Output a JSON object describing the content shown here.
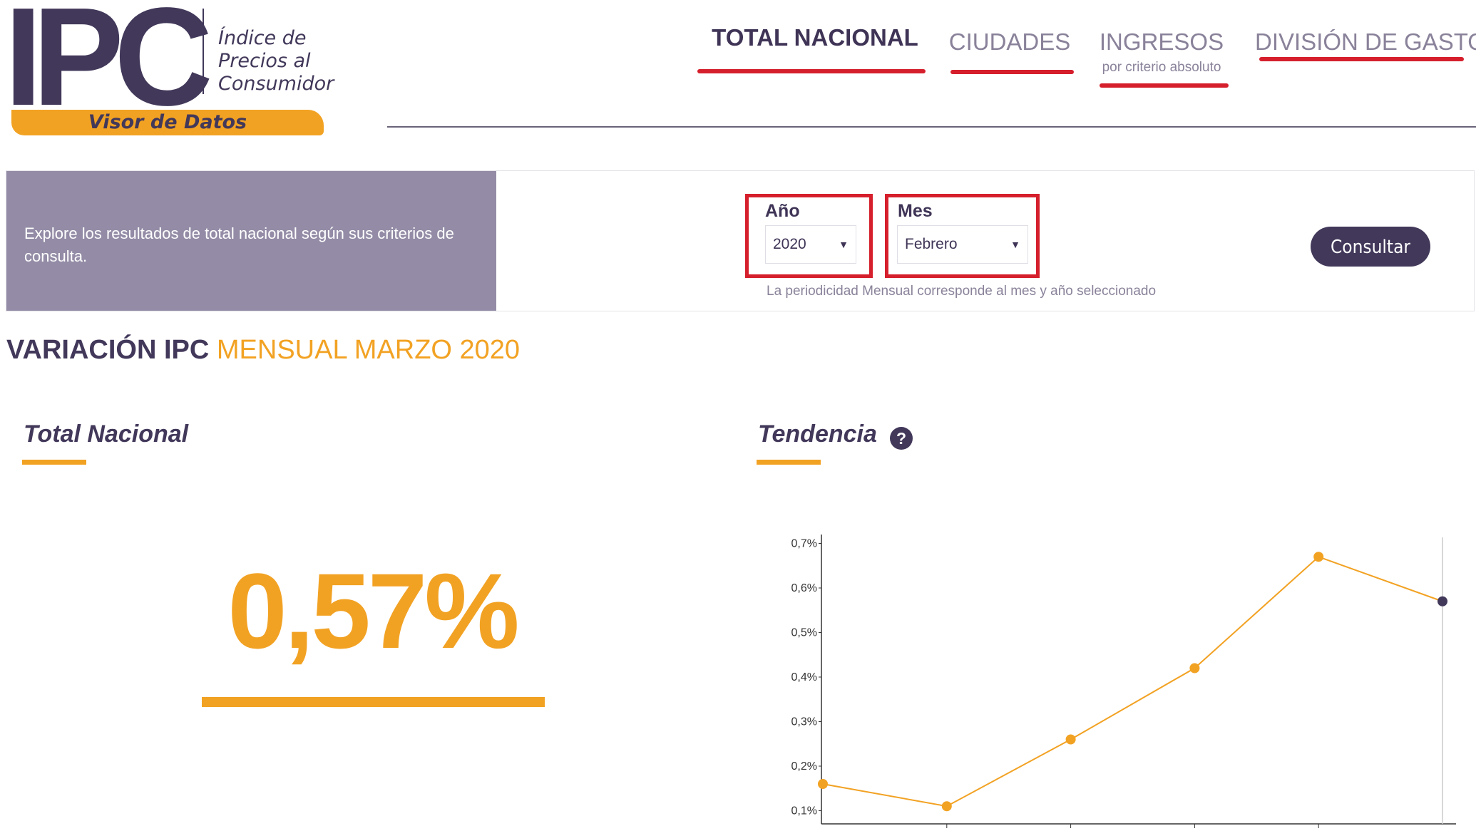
{
  "logo": {
    "mark": "IPC",
    "subtitle_lines": [
      "Índice de",
      "Precios al",
      "Consumidor"
    ],
    "ribbon": "Visor de Datos"
  },
  "nav": {
    "tabs": [
      {
        "label": "TOTAL NACIONAL",
        "sub": ""
      },
      {
        "label": "CIUDADES",
        "sub": ""
      },
      {
        "label": "INGRESOS",
        "sub": "por criterio absoluto"
      },
      {
        "label": "DIVISIÓN DE GASTO",
        "sub": ""
      }
    ]
  },
  "filter": {
    "intro": "Explore los resultados de total nacional según sus criterios de consulta.",
    "year_label": "Año",
    "year_value": "2020",
    "month_label": "Mes",
    "month_value": "Febrero",
    "note": "La periodicidad Mensual corresponde al mes y año seleccionado",
    "button": "Consultar"
  },
  "section": {
    "title_a": "VARIACIÓN IPC",
    "title_b": "MENSUAL MARZO 2020"
  },
  "total": {
    "title": "Total Nacional",
    "value": "0,57%"
  },
  "trend": {
    "title": "Tendencia",
    "help": "?"
  },
  "colors": {
    "primary": "#42385a",
    "accent": "#f2a223",
    "highlight_red": "#d61f2c",
    "panel": "#948ca6"
  },
  "chart_data": {
    "type": "line",
    "y_ticks": [
      "0,1%",
      "0,2%",
      "0,3%",
      "0,4%",
      "0,5%",
      "0,6%",
      "0,7%"
    ],
    "ylim": [
      0.08,
      0.72
    ],
    "series": [
      {
        "values": [
          0.16,
          0.11,
          0.26,
          0.42,
          0.67,
          0.57
        ]
      }
    ],
    "color": "#f2a223",
    "last_point_color": "#42385a"
  }
}
